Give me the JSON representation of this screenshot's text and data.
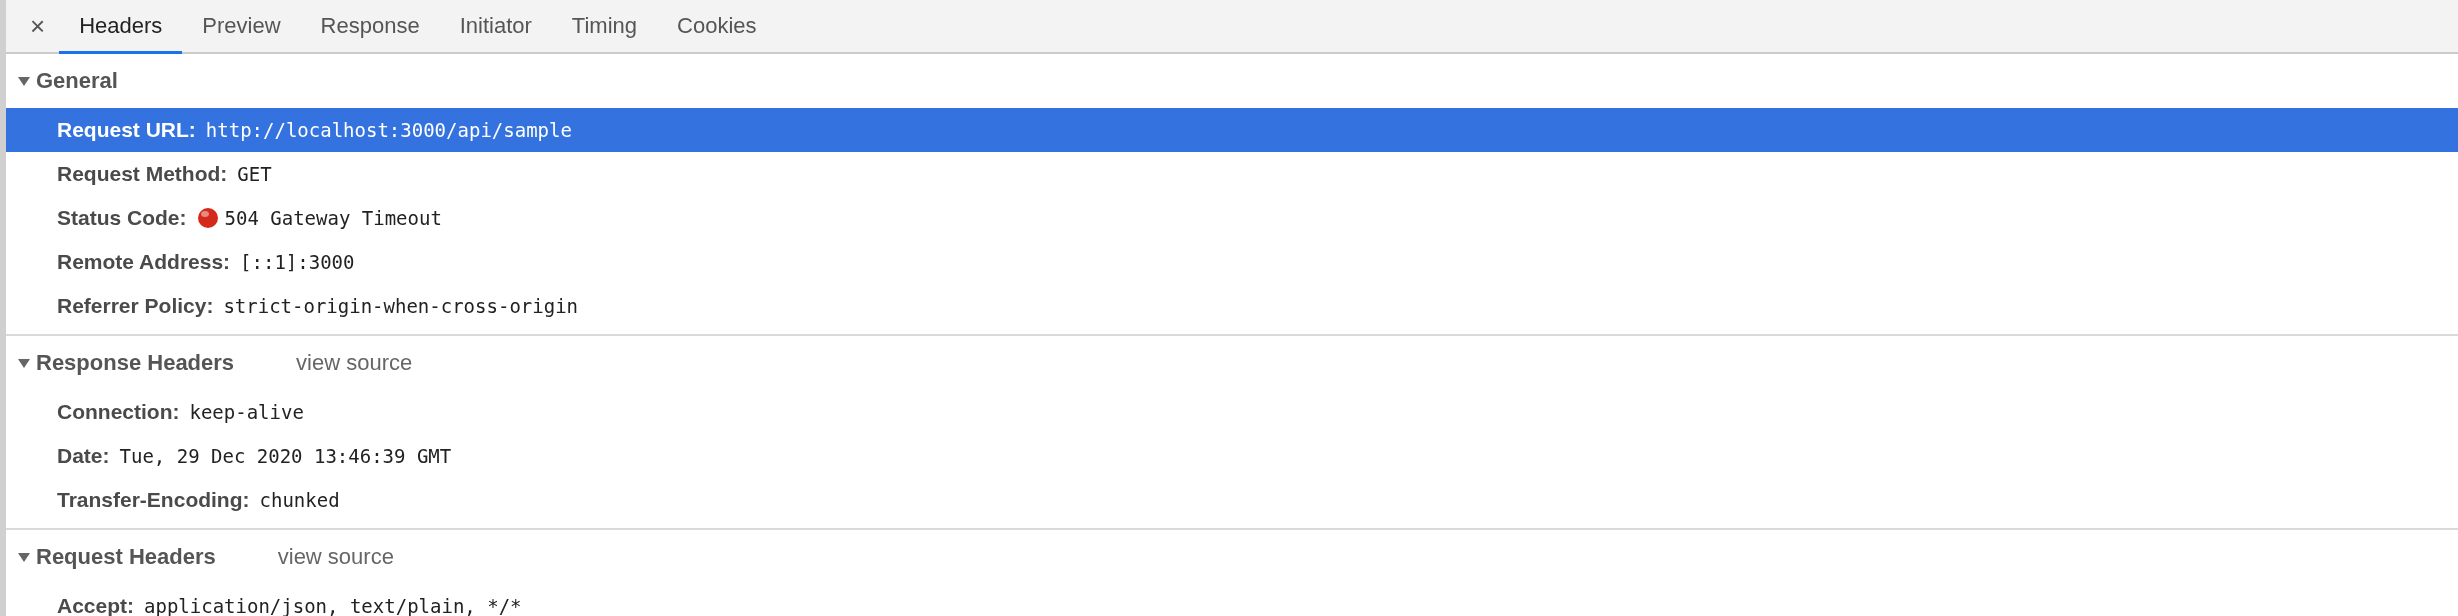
{
  "close_button": "×",
  "tabs": [
    {
      "label": "Headers",
      "selected": true
    },
    {
      "label": "Preview",
      "selected": false
    },
    {
      "label": "Response",
      "selected": false
    },
    {
      "label": "Initiator",
      "selected": false
    },
    {
      "label": "Timing",
      "selected": false
    },
    {
      "label": "Cookies",
      "selected": false
    }
  ],
  "sections": [
    {
      "title": "General",
      "expanded": true,
      "rows": [
        {
          "name": "Request URL:",
          "value": "http://localhost:3000/api/sample",
          "selected": true
        },
        {
          "name": "Request Method:",
          "value": "GET",
          "selected": false
        },
        {
          "name": "Status Code:",
          "value": "504 Gateway Timeout",
          "selected": false,
          "color": "#d42a1c"
        },
        {
          "name": "Remote Address:",
          "value": "[::1]:3000",
          "selected": false
        },
        {
          "name": "Referrer Policy:",
          "value": "strict-origin-when-cross-origin",
          "selected": false
        }
      ]
    },
    {
      "title": "Response Headers",
      "link": "view source",
      "expanded": true,
      "rows": [
        {
          "name": "Connection:",
          "value": "keep-alive",
          "selected": false
        },
        {
          "name": "Date:",
          "value": "Tue, 29 Dec 2020 13:46:39 GMT",
          "selected": false
        },
        {
          "name": "Transfer-Encoding:",
          "value": "chunked",
          "selected": false
        }
      ]
    },
    {
      "title": "Request Headers",
      "link": "view source",
      "expanded": true,
      "rows": [
        {
          "name": "Accept:",
          "value": "application/json, text/plain, */*",
          "selected": false
        }
      ]
    }
  ]
}
